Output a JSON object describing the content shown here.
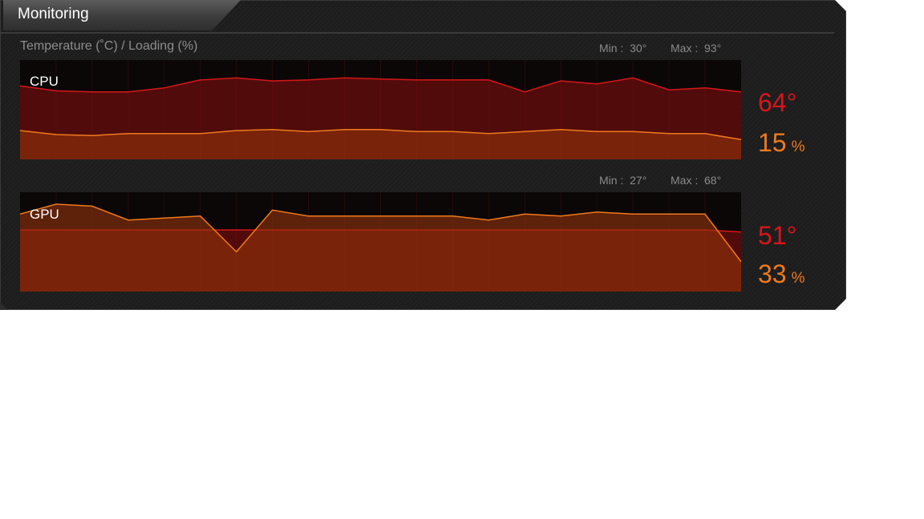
{
  "window": {
    "title": "Monitoring"
  },
  "subtitle": "Temperature (˚C) / Loading (%)",
  "colors": {
    "temperature": "#d8161a",
    "loading": "#ef7a1c",
    "background": "#1c1c1d"
  },
  "cpu": {
    "label": "CPU",
    "min_label": "Min :",
    "min_value": "30°",
    "max_label": "Max :",
    "max_value": "93°",
    "temperature": "64°",
    "loading": "15",
    "loading_unit": "%"
  },
  "gpu": {
    "label": "GPU",
    "min_label": "Min :",
    "min_value": "27°",
    "max_label": "Max :",
    "max_value": "68°",
    "temperature": "51°",
    "loading": "33",
    "loading_unit": "%"
  },
  "chart_data": [
    {
      "type": "area",
      "title": "CPU",
      "ylim": [
        0,
        100
      ],
      "x": [
        0,
        5,
        10,
        15,
        20,
        25,
        30,
        35,
        40,
        45,
        50,
        55,
        60,
        65,
        70,
        75,
        80,
        85,
        90,
        95,
        100
      ],
      "series": [
        {
          "name": "",
          "values": [
            74,
            69,
            68,
            68,
            72,
            80,
            82,
            79,
            80,
            82,
            81,
            80,
            80,
            80,
            68,
            79,
            76,
            82,
            70,
            72,
            68
          ]
        },
        {
          "name": "",
          "values": [
            29,
            25,
            24,
            26,
            26,
            26,
            29,
            30,
            28,
            30,
            30,
            28,
            28,
            26,
            28,
            30,
            28,
            28,
            26,
            26,
            20
          ]
        }
      ]
    },
    {
      "type": "area",
      "title": "GPU",
      "ylim": [
        0,
        100
      ],
      "x": [
        0,
        5,
        10,
        15,
        20,
        25,
        30,
        35,
        40,
        45,
        50,
        55,
        60,
        65,
        70,
        75,
        80,
        85,
        90,
        95,
        100
      ],
      "series": [
        {
          "name": "",
          "values": [
            62,
            62,
            62,
            62,
            62,
            62,
            62,
            62,
            62,
            62,
            62,
            62,
            62,
            62,
            62,
            62,
            62,
            62,
            62,
            62,
            60
          ]
        },
        {
          "name": "",
          "values": [
            78,
            88,
            86,
            72,
            74,
            76,
            40,
            82,
            76,
            76,
            76,
            76,
            76,
            72,
            78,
            76,
            80,
            78,
            78,
            78,
            30
          ]
        }
      ]
    }
  ]
}
